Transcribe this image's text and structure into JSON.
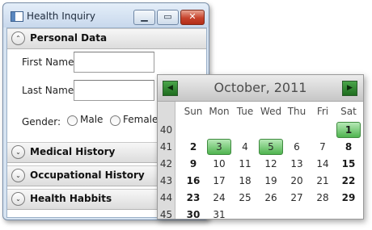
{
  "window": {
    "title": "Health Inquiry",
    "min_glyph": "▁",
    "max_glyph": "▭",
    "close_glyph": "✕"
  },
  "sections": {
    "personal": {
      "label": "Personal Data",
      "chevron": "⌃"
    },
    "medical": {
      "label": "Medical History",
      "chevron": "⌄"
    },
    "occupational": {
      "label": "Occupational History",
      "chevron": "⌄"
    },
    "health": {
      "label": "Health Habbits",
      "chevron": "⌄"
    }
  },
  "form": {
    "first_name_label": "First Name:",
    "first_name_value": "",
    "last_name_label": "Last Name:",
    "last_name_value": "",
    "gender_label": "Gender:",
    "gender_male": "Male",
    "gender_female": "Female",
    "gender_selected": ""
  },
  "calendar": {
    "month_title": "October, 2011",
    "prev_glyph": "◀",
    "next_glyph": "▶",
    "day_headers": [
      "Sun",
      "Mon",
      "Tue",
      "Wed",
      "Thu",
      "Fri",
      "Sat"
    ],
    "week_numbers": [
      "40",
      "41",
      "42",
      "43",
      "44",
      "45"
    ],
    "weeks": [
      [
        "",
        "",
        "",
        "",
        "",
        "",
        "1"
      ],
      [
        "2",
        "3",
        "4",
        "5",
        "6",
        "7",
        "8"
      ],
      [
        "9",
        "10",
        "11",
        "12",
        "13",
        "14",
        "15"
      ],
      [
        "16",
        "17",
        "18",
        "19",
        "20",
        "21",
        "22"
      ],
      [
        "23",
        "24",
        "25",
        "26",
        "27",
        "28",
        "29"
      ],
      [
        "30",
        "31",
        "",
        "",
        "",
        "",
        ""
      ]
    ],
    "highlighted_days": [
      "1",
      "3",
      "5"
    ],
    "accent_color": "#4fb44f"
  }
}
